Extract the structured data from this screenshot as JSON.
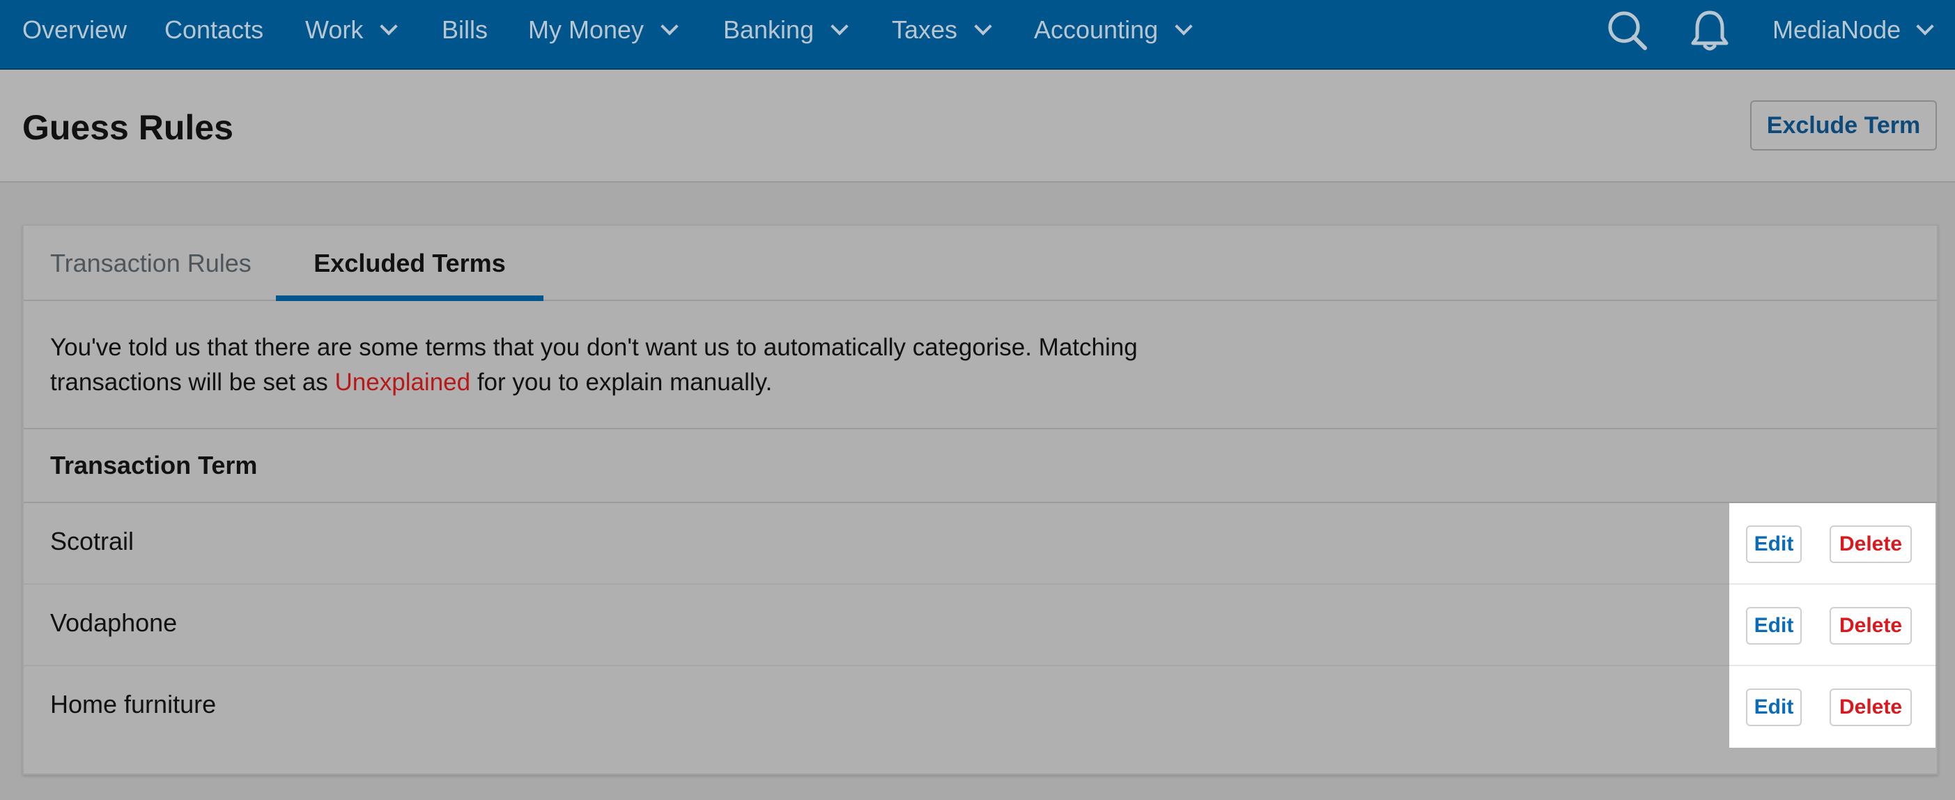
{
  "nav": {
    "items": [
      {
        "label": "Overview",
        "dropdown": false
      },
      {
        "label": "Contacts",
        "dropdown": false
      },
      {
        "label": "Work",
        "dropdown": true
      },
      {
        "label": "Bills",
        "dropdown": false
      },
      {
        "label": "My Money",
        "dropdown": true
      },
      {
        "label": "Banking",
        "dropdown": true
      },
      {
        "label": "Taxes",
        "dropdown": true
      },
      {
        "label": "Accounting",
        "dropdown": true
      }
    ],
    "user": "MediaNode",
    "icons": [
      "search-icon",
      "bell-icon"
    ]
  },
  "header": {
    "title": "Guess Rules",
    "exclude_button": "Exclude Term"
  },
  "tabs": [
    {
      "label": "Transaction Rules",
      "active": false
    },
    {
      "label": "Excluded Terms",
      "active": true
    }
  ],
  "intro": {
    "before": "You've told us that there are some terms that you don't want us to automatically categorise. Matching transactions will be set as ",
    "highlight": "Unexplained",
    "after": " for you to explain manually."
  },
  "table": {
    "header": "Transaction Term",
    "rows": [
      {
        "term": "Scotrail",
        "edit": "Edit",
        "delete": "Delete"
      },
      {
        "term": "Vodaphone",
        "edit": "Edit",
        "delete": "Delete"
      },
      {
        "term": "Home furniture",
        "edit": "Edit",
        "delete": "Delete"
      }
    ]
  },
  "colors": {
    "nav_bg": "#00558c",
    "highlight_red": "#b81818",
    "edit_blue": "#0a6cb8",
    "delete_red": "#d9191e"
  }
}
